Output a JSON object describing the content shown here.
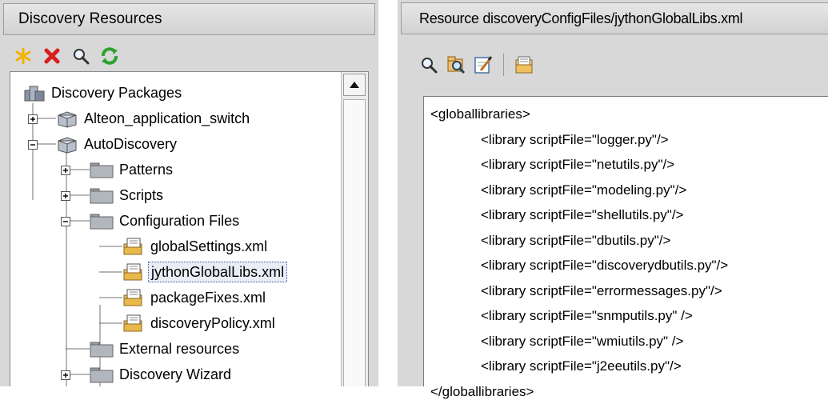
{
  "left": {
    "title": "Discovery Resources",
    "toolbar": [
      "new-star-icon",
      "delete-x-icon",
      "search-icon",
      "refresh-icon"
    ],
    "tree": [
      {
        "label": "Discovery Packages",
        "icon": "packages-root-icon",
        "expander": "none"
      },
      {
        "label": "Alteon_application_switch",
        "icon": "package-icon",
        "expander": "plus"
      },
      {
        "label": "AutoDiscovery",
        "icon": "package-icon",
        "expander": "minus"
      },
      {
        "label": "Patterns",
        "icon": "folder-icon",
        "expander": "plus"
      },
      {
        "label": "Scripts",
        "icon": "folder-icon",
        "expander": "plus"
      },
      {
        "label": "Configuration Files",
        "icon": "folder-icon",
        "expander": "minus"
      },
      {
        "label": "globalSettings.xml",
        "icon": "config-file-icon",
        "expander": "none"
      },
      {
        "label": "jythonGlobalLibs.xml",
        "icon": "config-file-icon",
        "expander": "none",
        "selected": true
      },
      {
        "label": "packageFixes.xml",
        "icon": "config-file-icon",
        "expander": "none"
      },
      {
        "label": "discoveryPolicy.xml",
        "icon": "config-file-icon",
        "expander": "none"
      },
      {
        "label": "External resources",
        "icon": "folder-icon",
        "expander": "none"
      },
      {
        "label": "Discovery Wizard",
        "icon": "folder-icon",
        "expander": "plus"
      }
    ]
  },
  "right": {
    "title": "Resource discoveryConfigFiles/jythonGlobalLibs.xml",
    "toolbar": [
      "search-icon",
      "find-resource-icon",
      "edit-icon",
      "properties-icon"
    ],
    "code": [
      "<globallibraries>",
      "<library scriptFile=\"logger.py\"/>",
      "<library scriptFile=\"netutils.py\"/>",
      "<library scriptFile=\"modeling.py\"/>",
      "<library scriptFile=\"shellutils.py\"/>",
      "<library scriptFile=\"dbutils.py\"/>",
      "<library scriptFile=\"discoverydbutils.py\"/>",
      "<library scriptFile=\"errormessages.py\"/>",
      "<library scriptFile=\"snmputils.py\" />",
      "<library scriptFile=\"wmiutils.py\" />",
      "<library scriptFile=\"j2eeutils.py\"/>",
      "</globallibraries>"
    ]
  }
}
